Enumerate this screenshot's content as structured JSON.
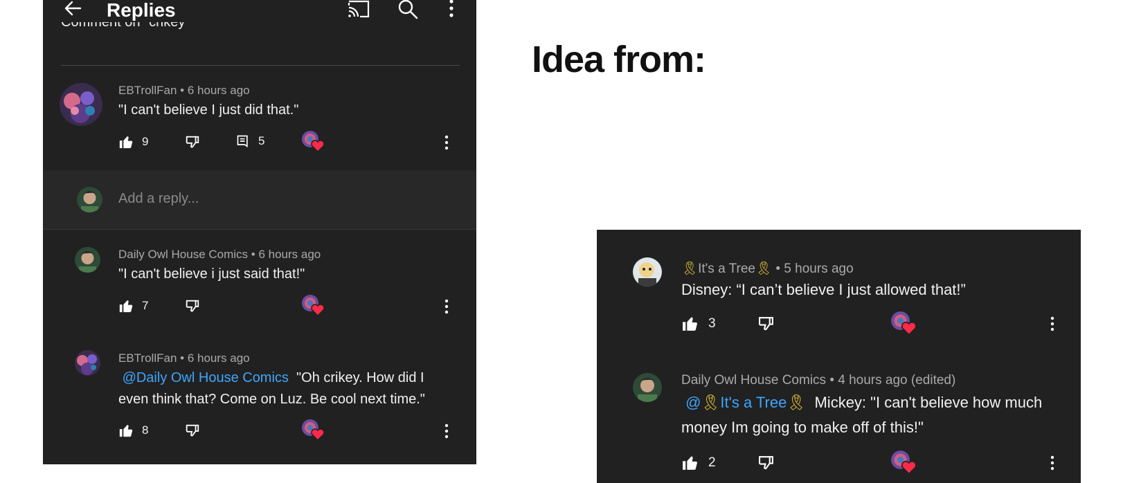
{
  "left": {
    "header": {
      "title": "Replies",
      "icons": [
        "back-arrow-icon",
        "cast-icon",
        "search-icon",
        "more-vert-icon"
      ],
      "subtitle": "Comment on \"crikey\""
    },
    "parent_comment": {
      "author": "EBTrollFan",
      "time": "6 hours ago",
      "text": "\"I can't believe I just did that.\"",
      "likes": "9",
      "replies": "5"
    },
    "reply_input": {
      "placeholder": "Add a reply..."
    },
    "replies": [
      {
        "author": "Daily Owl House Comics",
        "time": "6 hours ago",
        "text": "\"I can't believe i just said that!\"",
        "likes": "7"
      },
      {
        "author": "EBTrollFan",
        "time": "6 hours ago",
        "mention": "@Daily Owl House Comics",
        "text": "\"Oh crikey. How did I even think that? Come on Luz. Be cool next time.\"",
        "likes": "8"
      }
    ]
  },
  "right": {
    "heading": "Idea from:",
    "comments": [
      {
        "author": "It's a Tree",
        "time": "5 hours ago",
        "text": "Disney: “I can’t believe I just allowed that!”",
        "likes": "3"
      },
      {
        "author": "Daily Owl House Comics",
        "time": "4 hours ago (edited)",
        "mention_at": "@",
        "mention_name": "It's a Tree",
        "text": "Mickey: \"I can't believe how much money Im going to make off of this!\"",
        "likes": "2"
      }
    ]
  },
  "colors": {
    "panel_bg": "#212121",
    "reply_bar_bg": "#282828",
    "text": "#f1f1f1",
    "meta": "#aaaaaa",
    "mention": "#3ea6ff",
    "ribbon": "#e8c53a",
    "heart": "#ff2a4a"
  },
  "sep": "•"
}
